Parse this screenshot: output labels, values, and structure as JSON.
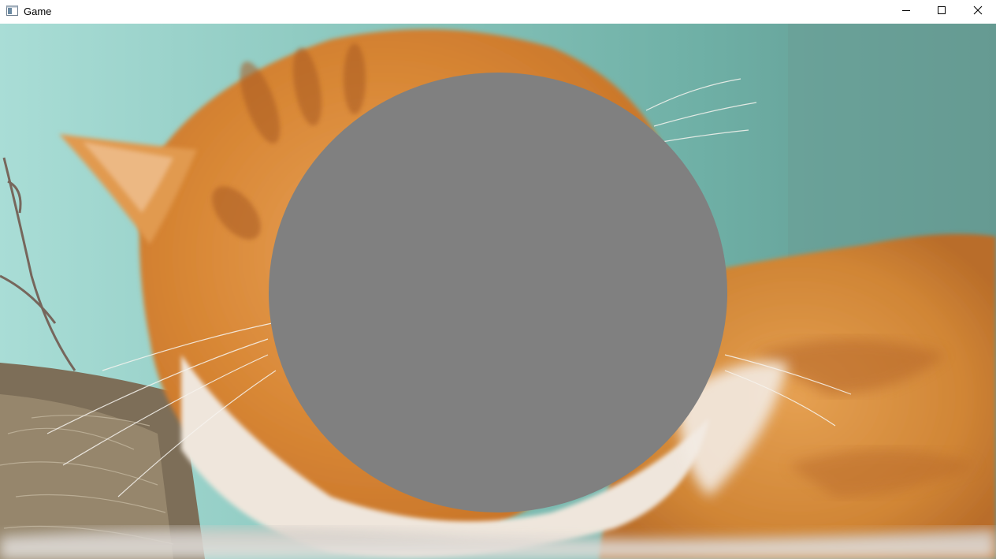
{
  "window": {
    "title": "Game",
    "icon": "app-window-icon",
    "controls": {
      "minimize_icon": "minimize-icon",
      "maximize_icon": "maximize-icon",
      "close_icon": "close-icon"
    }
  },
  "scene": {
    "background_image": "orange-white-cat-photo",
    "background_colors": {
      "wall": "#79b7ac",
      "fur_orange": "#d98a3a",
      "fur_white": "#eadfd2",
      "straw": "#8a7a62"
    },
    "circle": {
      "shape": "ellipse",
      "color": "#808080"
    }
  }
}
